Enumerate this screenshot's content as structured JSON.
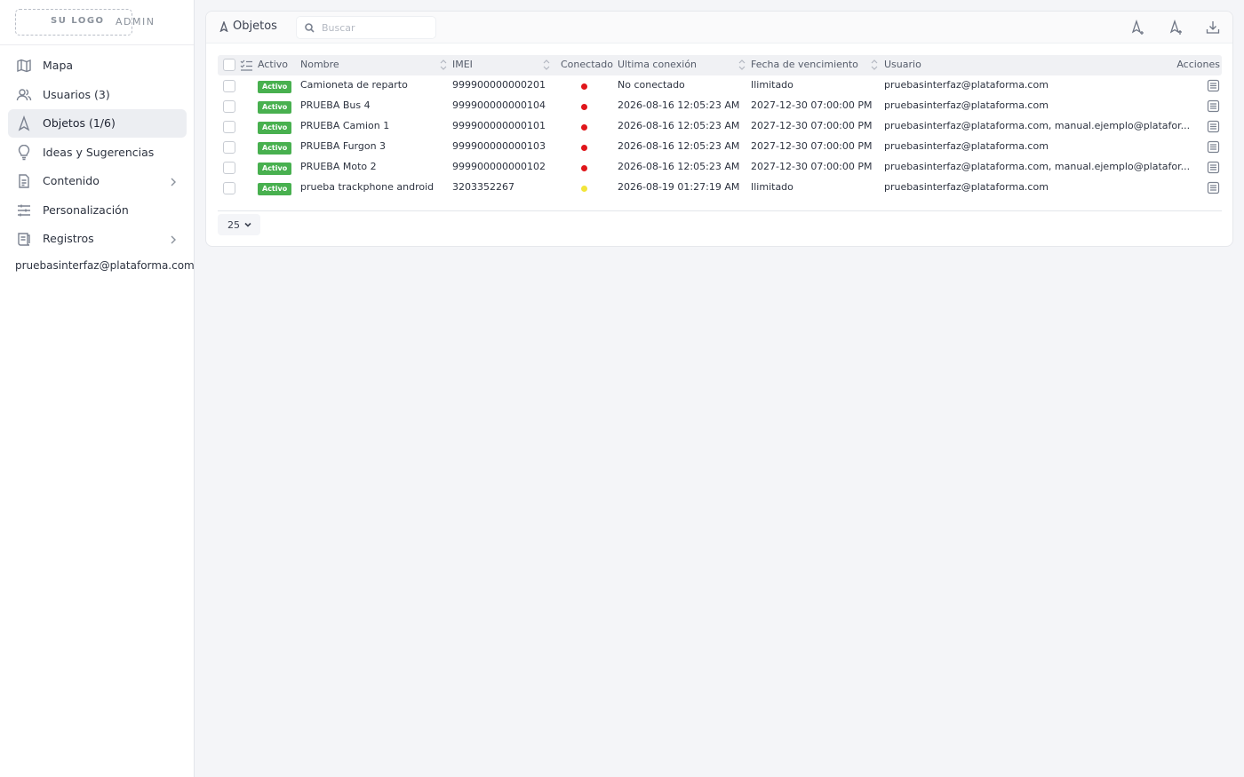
{
  "sidebar": {
    "logo": "SU LOGO",
    "admin": "ADMIN",
    "items": [
      {
        "label": "Mapa",
        "icon": "map-icon"
      },
      {
        "label": "Usuarios (3)",
        "icon": "users-icon"
      },
      {
        "label": "Objetos (1/6)",
        "icon": "navigation-icon",
        "active": true
      },
      {
        "label": "Ideas y Sugerencias",
        "icon": "lightbulb-icon"
      },
      {
        "label": "Contenido",
        "icon": "file-icon",
        "has_children": true
      },
      {
        "label": "Personalización",
        "icon": "sliders-icon"
      },
      {
        "label": "Registros",
        "icon": "scroll-icon",
        "has_children": true
      }
    ],
    "user": "pruebasinterfaz@plataforma.com (D"
  },
  "header": {
    "title": "Objetos",
    "search_placeholder": "Buscar"
  },
  "table": {
    "columns": {
      "activo": "Activo",
      "nombre": "Nombre",
      "imei": "IMEI",
      "conectado": "Conectado",
      "ultima": "Ultima conexión",
      "fecha": "Fecha de vencimiento",
      "usuario": "Usuario",
      "acciones": "Acciones"
    },
    "rows": [
      {
        "status": "Activo",
        "name": "Camioneta de reparto",
        "imei": "999900000000201",
        "connected_color": "#e0161b",
        "last": "No conectado",
        "expiry": "Ilimitado",
        "user": "pruebasinterfaz@plataforma.com"
      },
      {
        "status": "Activo",
        "name": "PRUEBA Bus 4",
        "imei": "999900000000104",
        "connected_color": "#e0161b",
        "last": "2026-08-16 12:05:23 AM",
        "expiry": "2027-12-30 07:00:00 PM",
        "user": "pruebasinterfaz@plataforma.com"
      },
      {
        "status": "Activo",
        "name": "PRUEBA Camion 1",
        "imei": "999900000000101",
        "connected_color": "#e0161b",
        "last": "2026-08-16 12:05:23 AM",
        "expiry": "2027-12-30 07:00:00 PM",
        "user": "pruebasinterfaz@plataforma.com, manual.ejemplo@platafor..."
      },
      {
        "status": "Activo",
        "name": "PRUEBA Furgon 3",
        "imei": "999900000000103",
        "connected_color": "#e0161b",
        "last": "2026-08-16 12:05:23 AM",
        "expiry": "2027-12-30 07:00:00 PM",
        "user": "pruebasinterfaz@plataforma.com"
      },
      {
        "status": "Activo",
        "name": "PRUEBA Moto 2",
        "imei": "999900000000102",
        "connected_color": "#e0161b",
        "last": "2026-08-16 12:05:23 AM",
        "expiry": "2027-12-30 07:00:00 PM",
        "user": "pruebasinterfaz@plataforma.com, manual.ejemplo@platafor..."
      },
      {
        "status": "Activo",
        "name": "prueba trackphone android",
        "imei": "3203352267",
        "connected_color": "#f2e53a",
        "last": "2026-08-19 01:27:19 AM",
        "expiry": "Ilimitado",
        "user": "pruebasinterfaz@plataforma.com"
      }
    ],
    "page_size": "25"
  },
  "colors": {
    "badge": "#48b04f",
    "offline": "#e0161b",
    "idle": "#f2e53a"
  }
}
